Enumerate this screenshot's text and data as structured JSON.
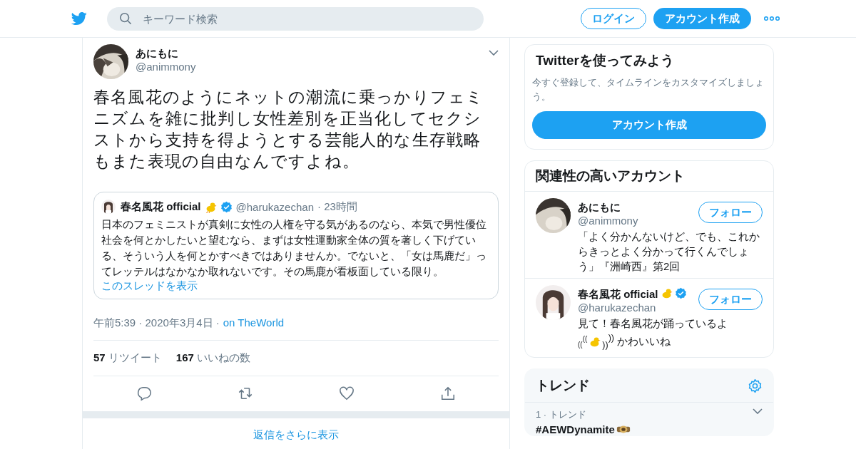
{
  "header": {
    "search": {
      "placeholder": "キーワード検索"
    },
    "login": "ログイン",
    "signup": "アカウント作成"
  },
  "tweet": {
    "name": "あにもに",
    "handle": "@animmony",
    "text": "春名風花のようにネットの潮流に乗っかりフェミニズムを雑に批判し女性差別を正当化してセクシストから支持を得ようとする芸能人的な生存戦略もまた表現の自由なんですよね。",
    "quote": {
      "name": "春名風花 official",
      "verified": true,
      "handle": "@harukazechan",
      "time": "· 23時間",
      "text": "日本のフェミニストが真剣に女性の人権を守る気があるのなら、本気で男性優位社会を何とかしたいと望むなら、まずは女性運動家全体の質を著しく下げている、そういう人を何とかすべきではありませんか。でないと、「女は馬鹿だ」ってレッテルはなかなか取れないです。その馬鹿が看板面している限り。",
      "thread_link": "このスレッドを表示"
    },
    "date": "午前5:39 · 2020年3月4日 ·",
    "source": "on TheWorld",
    "stats": [
      {
        "count": "57",
        "label": "リツイート"
      },
      {
        "count": "167",
        "label": "いいねの数"
      }
    ],
    "actions": [
      {
        "kind": "reply"
      },
      {
        "kind": "retweet"
      },
      {
        "kind": "like"
      },
      {
        "kind": "share"
      }
    ],
    "more_replies": "返信をさらに表示"
  },
  "signup_card": {
    "title": "Twitterを使ってみよう",
    "text": "今すぐ登録して、タイムラインをカスタマイズしましょう。",
    "button": "アカウント作成"
  },
  "related": {
    "title": "関連性の高いアカウント",
    "accounts": [
      {
        "name": "あにもに",
        "verified": false,
        "handle": "@animmony",
        "follow": "フォロー",
        "bio": [
          "「よく分かんないけど、でも、これからきっとよく分かって行くんでしょう」『洲崎西』第2回"
        ]
      },
      {
        "name": "春名風花 official",
        "verified": true,
        "handle": "@harukazechan",
        "follow": "フォロー",
        "bio": [
          "見て！春名風花が踊っているよ",
          "$_{((}$$^{((}$",
          "$_{))}$$^{))}$ かわいいね"
        ]
      }
    ]
  },
  "trends": {
    "title": "トレンド",
    "items": [
      {
        "rank": "1 · トレンド",
        "tag": "#AEWDynamite"
      }
    ]
  }
}
